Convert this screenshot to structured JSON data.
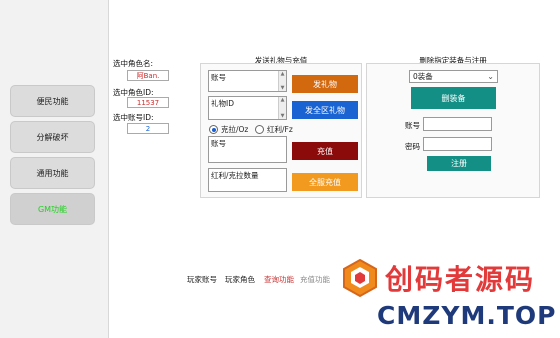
{
  "sidebar": {
    "items": [
      {
        "label": "便民功能"
      },
      {
        "label": "分解破坏"
      },
      {
        "label": "通用功能"
      },
      {
        "label": "GM功能"
      }
    ]
  },
  "selected": {
    "role_name_label": "选中角色名:",
    "role_name_value": "阿Ban.",
    "role_id_label": "选中角色ID:",
    "role_id_value": "11537",
    "account_id_label": "选中账号ID:",
    "account_id_value": "2"
  },
  "gift_panel": {
    "title": "发送礼物与充值",
    "account_label": "账号",
    "gift_id_label": "礼物ID",
    "send_gift_button": "发礼物",
    "send_all_button": "发全区礼物",
    "radio_options": [
      {
        "label": "克拉/Oz",
        "checked": true
      },
      {
        "label": "红利/Fz",
        "checked": false
      }
    ],
    "account2_label": "账号",
    "recharge_button": "充值",
    "amount_label": "红利/克拉数量",
    "recharge_all_button": "全服充值"
  },
  "equip_panel": {
    "title": "删除指定装备与注册",
    "select_value": "0装备",
    "delete_button": "删装备",
    "account_label": "账号",
    "password_label": "密码",
    "register_button": "注册"
  },
  "status_bar": {
    "player_account": "玩家账号",
    "player_role": "玩家角色",
    "query_label": "查询功能",
    "recharge_label": "充值功能"
  },
  "watermark": {
    "cn": "创码者源码",
    "en": "CMZYM.TOP"
  },
  "colors": {
    "orange": "#d3690f",
    "blue": "#1a63d2",
    "dark_red": "#8b0a0a",
    "light_orange": "#f29a1f",
    "teal": "#138f86",
    "gm_green": "#1fd11f",
    "selected_red": "#cc2d2d"
  }
}
